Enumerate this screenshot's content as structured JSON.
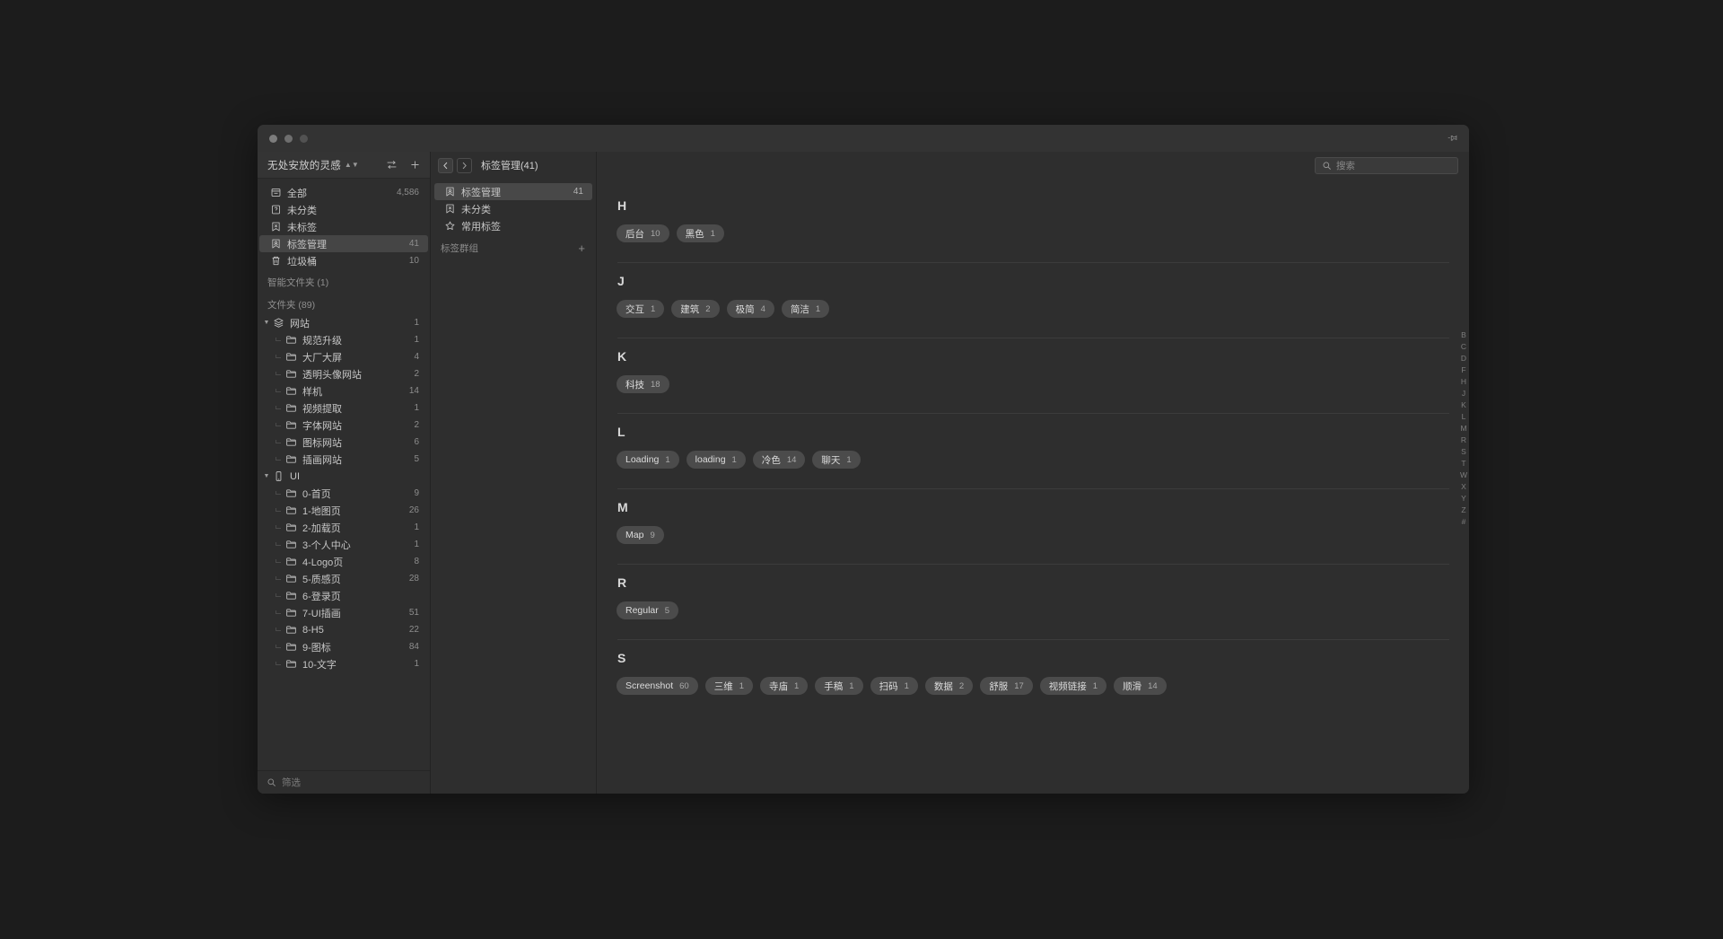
{
  "window": {
    "traffic_lights": [
      "close",
      "minimize",
      "maximize"
    ],
    "pin_icon": "pin-icon"
  },
  "sidebar": {
    "library_title": "无处安放的灵感",
    "sort_icon": "sort-swap-icon",
    "add_icon": "plus-icon",
    "nav_items": [
      {
        "icon": "archive-all-icon",
        "label": "全部",
        "count": "4,586",
        "selected": false
      },
      {
        "icon": "uncategorized-icon",
        "label": "未分类",
        "count": "",
        "selected": false
      },
      {
        "icon": "untagged-icon",
        "label": "未标签",
        "count": "",
        "selected": false
      },
      {
        "icon": "tag-manager-icon",
        "label": "标签管理",
        "count": "41",
        "selected": true
      },
      {
        "icon": "trash-icon",
        "label": "垃圾桶",
        "count": "10",
        "selected": false
      }
    ],
    "smart_folder_label": "智能文件夹 (1)",
    "folder_label": "文件夹 (89)",
    "tree": [
      {
        "type": "group",
        "icon": "layers-icon",
        "label": "网站",
        "count": "1",
        "expanded": true
      },
      {
        "type": "child",
        "icon": "folder-icon",
        "label": "规范升级",
        "count": "1"
      },
      {
        "type": "child",
        "icon": "folder-icon",
        "label": "大厂大屏",
        "count": "4"
      },
      {
        "type": "child",
        "icon": "folder-icon",
        "label": "透明头像网站",
        "count": "2"
      },
      {
        "type": "child",
        "icon": "folder-icon",
        "label": "样机",
        "count": "14"
      },
      {
        "type": "child",
        "icon": "folder-icon",
        "label": "视频提取",
        "count": "1"
      },
      {
        "type": "child",
        "icon": "folder-icon",
        "label": "字体网站",
        "count": "2"
      },
      {
        "type": "child",
        "icon": "folder-icon",
        "label": "图标网站",
        "count": "6"
      },
      {
        "type": "child",
        "icon": "folder-icon",
        "label": "插画网站",
        "count": "5"
      },
      {
        "type": "group",
        "icon": "phone-icon",
        "label": "UI",
        "count": "",
        "expanded": true
      },
      {
        "type": "child",
        "icon": "folder-icon",
        "label": "0-首页",
        "count": "9"
      },
      {
        "type": "child",
        "icon": "folder-icon",
        "label": "1-地图页",
        "count": "26"
      },
      {
        "type": "child",
        "icon": "folder-icon",
        "label": "2-加载页",
        "count": "1"
      },
      {
        "type": "child",
        "icon": "folder-icon",
        "label": "3-个人中心",
        "count": "1"
      },
      {
        "type": "child",
        "icon": "folder-icon",
        "label": "4-Logo页",
        "count": "8"
      },
      {
        "type": "child",
        "icon": "folder-icon",
        "label": "5-质感页",
        "count": "28"
      },
      {
        "type": "child",
        "icon": "folder-icon",
        "label": "6-登录页",
        "count": ""
      },
      {
        "type": "child",
        "icon": "folder-icon",
        "label": "7-UI插画",
        "count": "51"
      },
      {
        "type": "child",
        "icon": "folder-icon",
        "label": "8-H5",
        "count": "22"
      },
      {
        "type": "child",
        "icon": "folder-icon",
        "label": "9-图标",
        "count": "84"
      },
      {
        "type": "child",
        "icon": "folder-icon",
        "label": "10-文字",
        "count": "1"
      }
    ],
    "filter_placeholder": "筛选",
    "filter_icon": "search-icon"
  },
  "midpanel": {
    "back_icon": "chevron-left-icon",
    "forward_icon": "chevron-right-icon",
    "breadcrumb": "标签管理(41)",
    "items": [
      {
        "icon": "tag-manager-icon",
        "label": "标签管理",
        "count": "41",
        "selected": true
      },
      {
        "icon": "untagged-icon",
        "label": "未分类",
        "count": "",
        "selected": false
      },
      {
        "icon": "star-icon",
        "label": "常用标签",
        "count": "",
        "selected": false
      }
    ],
    "group_label": "标签群组",
    "group_add_icon": "plus-icon"
  },
  "content": {
    "search_placeholder": "搜索",
    "search_icon": "search-icon",
    "sections": [
      {
        "letter": "H",
        "tags": [
          {
            "name": "后台",
            "count": "10"
          },
          {
            "name": "黑色",
            "count": "1"
          }
        ]
      },
      {
        "letter": "J",
        "tags": [
          {
            "name": "交互",
            "count": "1"
          },
          {
            "name": "建筑",
            "count": "2"
          },
          {
            "name": "极简",
            "count": "4"
          },
          {
            "name": "简洁",
            "count": "1"
          }
        ]
      },
      {
        "letter": "K",
        "tags": [
          {
            "name": "科技",
            "count": "18"
          }
        ]
      },
      {
        "letter": "L",
        "tags": [
          {
            "name": "Loading",
            "count": "1"
          },
          {
            "name": "loading",
            "count": "1"
          },
          {
            "name": "冷色",
            "count": "14"
          },
          {
            "name": "聊天",
            "count": "1"
          }
        ]
      },
      {
        "letter": "M",
        "tags": [
          {
            "name": "Map",
            "count": "9"
          }
        ]
      },
      {
        "letter": "R",
        "tags": [
          {
            "name": "Regular",
            "count": "5"
          }
        ]
      },
      {
        "letter": "S",
        "tags": [
          {
            "name": "Screenshot",
            "count": "60"
          },
          {
            "name": "三维",
            "count": "1"
          },
          {
            "name": "寺庙",
            "count": "1"
          },
          {
            "name": "手稿",
            "count": "1"
          },
          {
            "name": "扫码",
            "count": "1"
          },
          {
            "name": "数据",
            "count": "2"
          },
          {
            "name": "舒服",
            "count": "17"
          },
          {
            "name": "视频链接",
            "count": "1"
          },
          {
            "name": "顺滑",
            "count": "14"
          }
        ]
      }
    ],
    "alphabet_index": [
      "B",
      "C",
      "D",
      "F",
      "H",
      "J",
      "K",
      "L",
      "M",
      "R",
      "S",
      "T",
      "W",
      "X",
      "Y",
      "Z",
      "#"
    ]
  },
  "colors": {
    "app_background": "#1c1c1c",
    "panel_background": "#2e2e2e",
    "titlebar": "#333333",
    "selected_row": "#484848",
    "pill_background": "#4b4b4b",
    "text_primary": "#d2d2d2",
    "text_secondary": "#8d8d8d"
  }
}
